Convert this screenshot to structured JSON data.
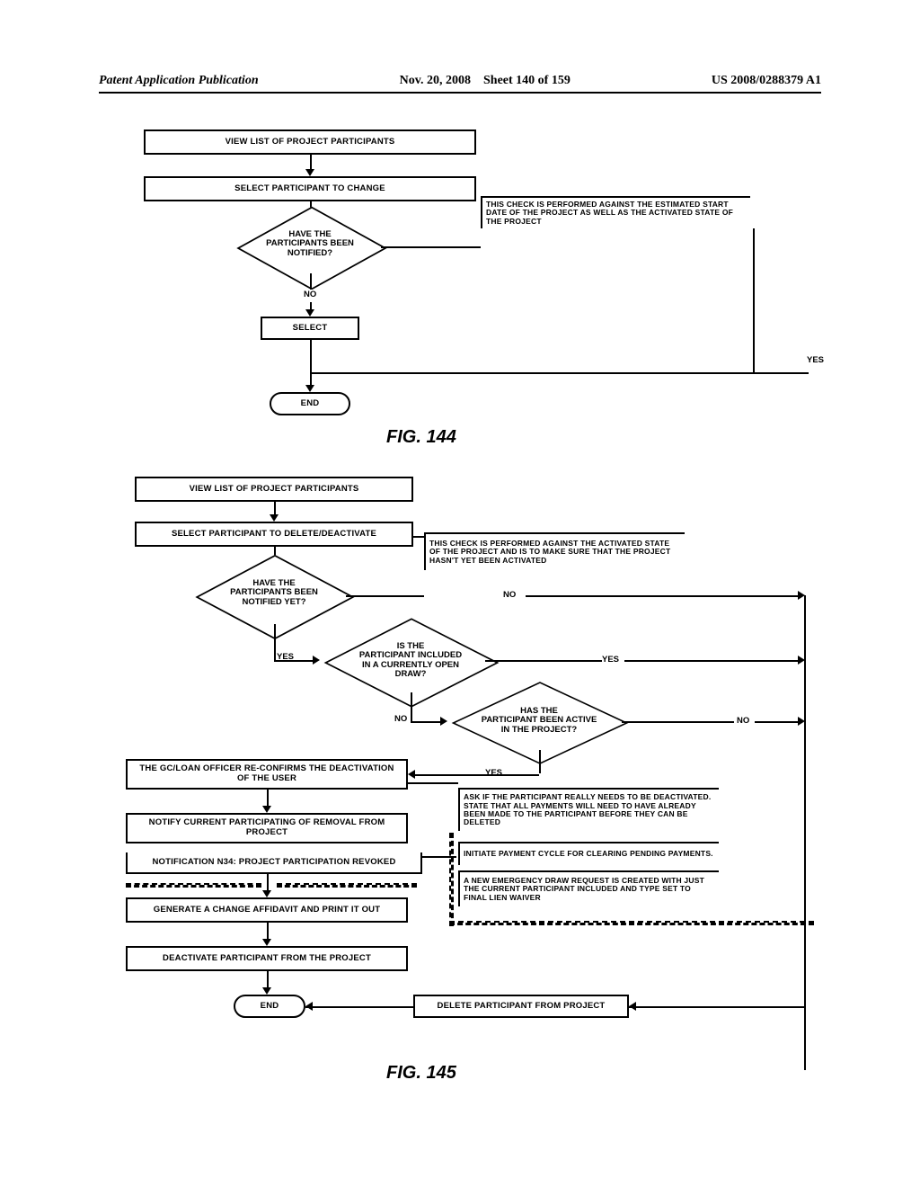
{
  "header": {
    "left": "Patent Application Publication",
    "date": "Nov. 20, 2008",
    "sheet": "Sheet 140 of 159",
    "docno": "US 2008/0288379 A1"
  },
  "fig144": {
    "caption": "FIG. 144",
    "blocks": {
      "view": "VIEW LIST OF PROJECT PARTICIPANTS",
      "select_change": "SELECT PARTICIPANT TO CHANGE",
      "decision": "HAVE THE\nPARTICIPANTS BEEN\nNOTIFIED?",
      "no": "NO",
      "select": "SELECT",
      "end": "END",
      "yes": "YES",
      "note": "THIS CHECK IS PERFORMED AGAINST THE ESTIMATED START DATE OF THE PROJECT AS WELL AS THE ACTIVATED STATE OF THE PROJECT"
    }
  },
  "fig145": {
    "caption": "FIG. 145",
    "blocks": {
      "view": "VIEW LIST OF PROJECT PARTICIPANTS",
      "select_del": "SELECT PARTICIPANT TO DELETE/DEACTIVATE",
      "d1": "HAVE THE\nPARTICIPANTS BEEN\nNOTIFIED YET?",
      "d2": "IS THE\nPARTICIPANT INCLUDED\nIN A CURRENTLY OPEN\nDRAW?",
      "d3": "HAS THE\nPARTICIPANT BEEN ACTIVE\nIN THE PROJECT?",
      "reconfirm": "THE GC/LOAN OFFICER RE-CONFIRMS THE DEACTIVATION\nOF THE USER",
      "notify_remove": "NOTIFY CURRENT PARTICIPATING OF REMOVAL FROM\nPROJECT",
      "n34": "NOTIFICATION N34: PROJECT PARTICIPATION REVOKED",
      "affidavit": "GENERATE A CHANGE AFFIDAVIT AND PRINT IT OUT",
      "deactivate": "DEACTIVATE PARTICIPANT FROM THE PROJECT",
      "end": "END",
      "delete_block": "DELETE PARTICIPANT FROM PROJECT",
      "note1": "THIS CHECK IS PERFORMED AGAINST THE ACTIVATED STATE OF THE PROJECT AND IS TO MAKE SURE THAT THE PROJECT HASN'T YET BEEN ACTIVATED",
      "note2": "ASK IF THE PARTICIPANT REALLY NEEDS TO BE DEACTIVATED. STATE THAT ALL PAYMENTS WILL NEED TO HAVE ALREADY BEEN MADE TO THE PARTICIPANT BEFORE THEY CAN BE DELETED",
      "note3": "INITIATE PAYMENT  CYCLE FOR CLEARING PENDING PAYMENTS.",
      "note4": "A NEW EMERGENCY DRAW REQUEST IS CREATED WITH JUST THE CURRENT PARTICIPANT INCLUDED AND TYPE SET TO FINAL LIEN WAIVER",
      "yes": "YES",
      "no": "NO"
    }
  }
}
